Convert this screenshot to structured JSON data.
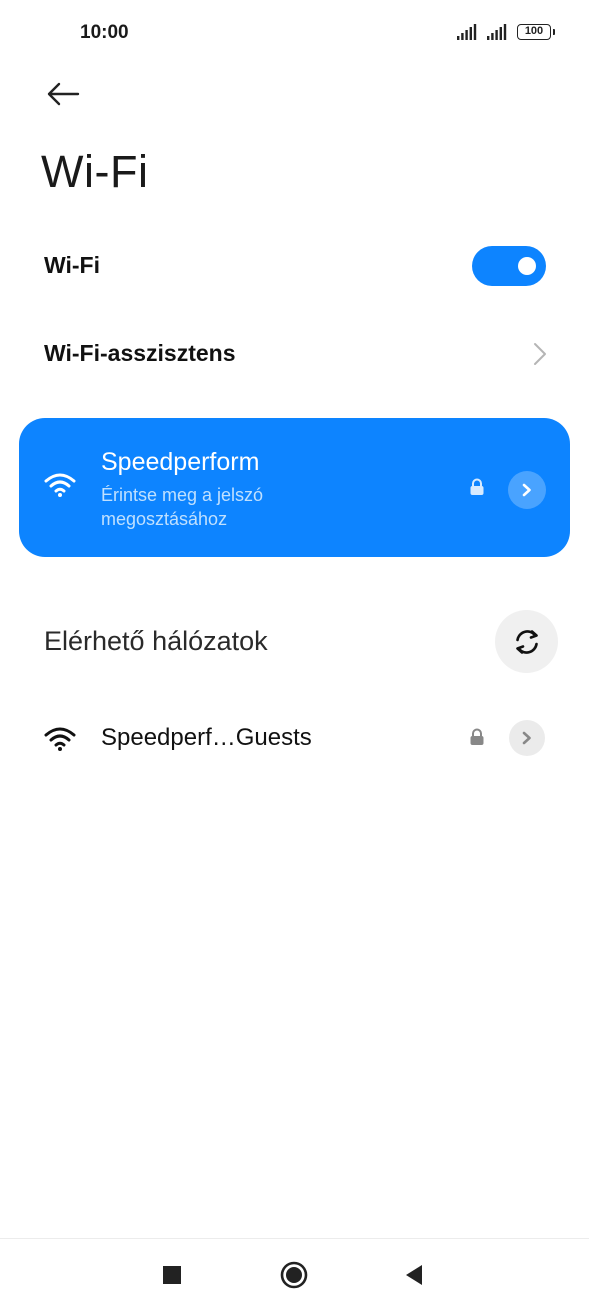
{
  "status_bar": {
    "time": "10:00",
    "battery": "100"
  },
  "page": {
    "title": "Wi-Fi"
  },
  "wifi_toggle": {
    "label": "Wi-Fi",
    "enabled": true,
    "on_color": "#0d84ff"
  },
  "assistant": {
    "label": "Wi-Fi-asszisztens"
  },
  "connected_network": {
    "name": "Speedperform",
    "subtitle": "Érintse meg a jelszó megosztásához",
    "secured": true,
    "card_color": "#0d84ff"
  },
  "available_section": {
    "title": "Elérhető hálózatok"
  },
  "networks": [
    {
      "name": "Speedperf…Guests",
      "secured": true
    }
  ],
  "icons": {
    "back": "arrow-left-icon",
    "chevron": "chevron-right-icon",
    "wifi": "wifi-icon",
    "lock": "lock-icon",
    "refresh": "refresh-icon",
    "nav_recents": "square-icon",
    "nav_home": "circle-icon",
    "nav_back": "triangle-back-icon"
  }
}
